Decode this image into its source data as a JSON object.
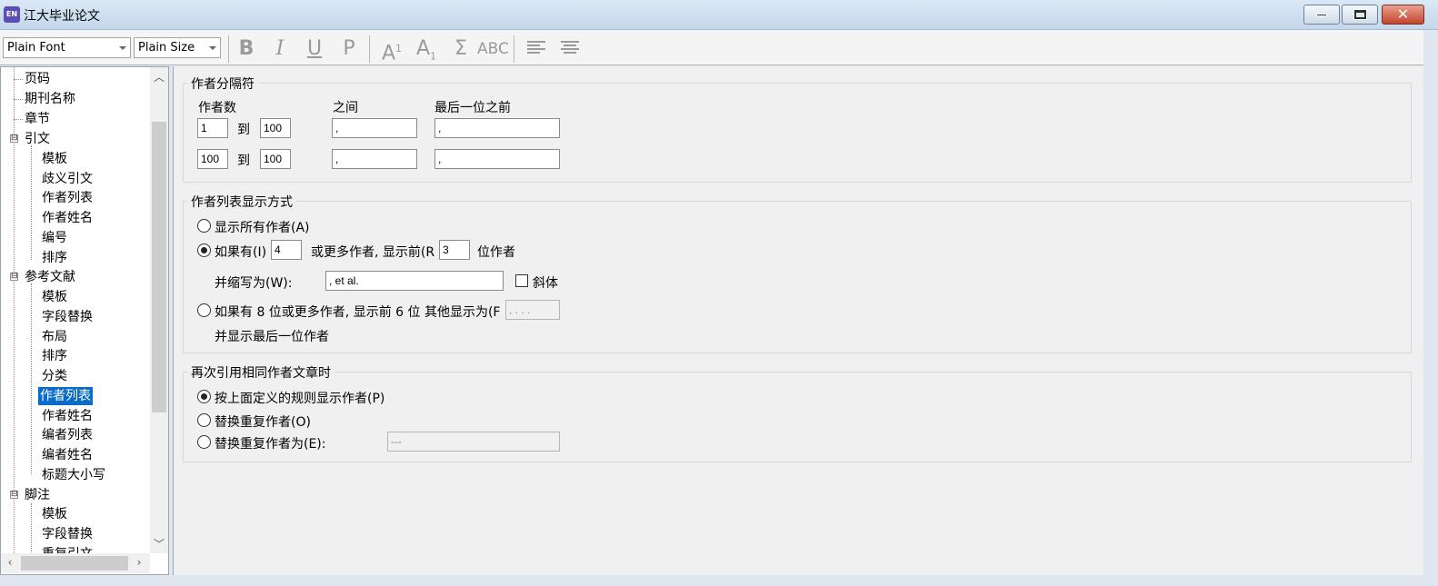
{
  "window": {
    "title": "江大毕业论文",
    "app_icon_text": "EN",
    "minimize_label": "minimize",
    "maximize_label": "maximize",
    "close_label": "close"
  },
  "toolbar": {
    "font_combo": "Plain Font",
    "size_combo": "Plain Size",
    "bold": "B",
    "italic": "I",
    "underline": "U",
    "plain": "P",
    "superscript": "A",
    "superscript_mark": "1",
    "subscript": "A",
    "subscript_mark": "1",
    "symbol": "Σ",
    "smallcaps": "ABC"
  },
  "tree": {
    "items": [
      {
        "label": "页码"
      },
      {
        "label": "期刊名称"
      },
      {
        "label": "章节"
      },
      {
        "label": "引文"
      },
      {
        "label": "模板"
      },
      {
        "label": "歧义引文"
      },
      {
        "label": "作者列表"
      },
      {
        "label": "作者姓名"
      },
      {
        "label": "编号"
      },
      {
        "label": "排序"
      },
      {
        "label": "参考文献"
      },
      {
        "label": "模板"
      },
      {
        "label": "字段替换"
      },
      {
        "label": "布局"
      },
      {
        "label": "排序"
      },
      {
        "label": "分类"
      },
      {
        "label": "作者列表"
      },
      {
        "label": "作者姓名"
      },
      {
        "label": "编者列表"
      },
      {
        "label": "编者姓名"
      },
      {
        "label": "标题大小写"
      },
      {
        "label": "脚注"
      },
      {
        "label": "模板"
      },
      {
        "label": "字段替换"
      },
      {
        "label": "重复引文"
      }
    ],
    "toggles": [
      "⊟",
      "⊟",
      "⊟"
    ]
  },
  "separators": {
    "title": "作者分隔符",
    "col_author_count": "作者数",
    "col_between": "之间",
    "col_before_last": "最后一位之前",
    "to": "到",
    "rows": [
      {
        "from": "1",
        "to": "100",
        "between": ",",
        "before_last": ","
      },
      {
        "from": "100",
        "to": "100",
        "between": ",",
        "before_last": ","
      }
    ]
  },
  "display": {
    "title": "作者列表显示方式",
    "show_all": "显示所有作者(A)",
    "if_have": "如果有(I)",
    "if_have_count": "4",
    "or_more_show_first": "或更多作者, 显示前(R",
    "show_first_count": "3",
    "authors_suffix": "位作者",
    "abbrev_label": "并缩写为(W):",
    "abbrev_value": ", et al.",
    "italic_label": "斜体",
    "alt_option": "如果有 8 位或更多作者, 显示前 6 位 其他显示为(F",
    "alt_value": ", . . .",
    "show_last": "并显示最后一位作者"
  },
  "repeat": {
    "title": "再次引用相同作者文章时",
    "opt_rules": "按上面定义的规则显示作者(P)",
    "opt_replace": "替换重复作者(O)",
    "opt_replace_with": "替换重复作者为(E):",
    "replace_value": "---"
  }
}
